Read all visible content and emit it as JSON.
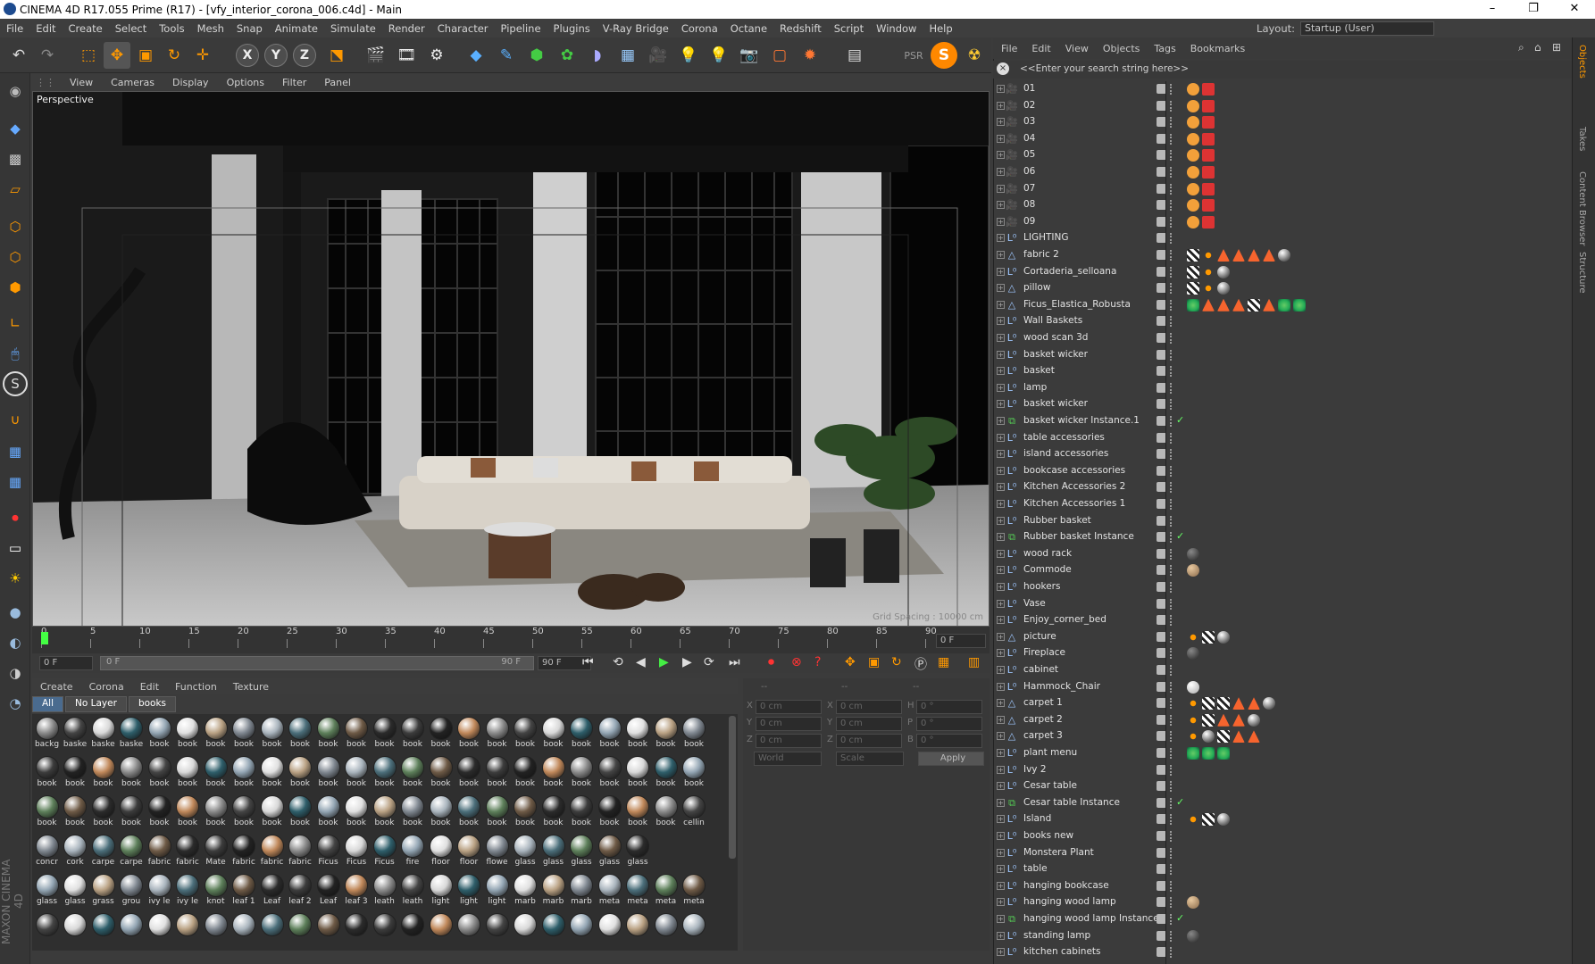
{
  "window": {
    "title": "CINEMA 4D R17.055 Prime (R17) - [vfy_interior_corona_006.c4d] - Main",
    "min_glyph": "–",
    "max_glyph": "❐",
    "close_glyph": "✕"
  },
  "menubar": {
    "items": [
      "File",
      "Edit",
      "Create",
      "Select",
      "Tools",
      "Mesh",
      "Snap",
      "Animate",
      "Simulate",
      "Render",
      "Character",
      "Pipeline",
      "Plugins",
      "V-Ray Bridge",
      "Corona",
      "Octane",
      "Redshift",
      "Script",
      "Window",
      "Help"
    ],
    "layout_label": "Layout:",
    "layout_value": "Startup (User)"
  },
  "toolbar": {
    "axis_x": "X",
    "axis_y": "Y",
    "axis_z": "Z"
  },
  "viewport": {
    "menu": [
      "View",
      "Cameras",
      "Display",
      "Options",
      "Filter",
      "Panel"
    ],
    "label": "Perspective",
    "grid_spacing": "Grid Spacing : 10000 cm"
  },
  "timeline": {
    "ticks": [
      "0",
      "5",
      "10",
      "15",
      "20",
      "25",
      "30",
      "35",
      "40",
      "45",
      "50",
      "55",
      "60",
      "65",
      "70",
      "75",
      "80",
      "85",
      "90"
    ],
    "current_frame": "0 F",
    "start_field": "0 F",
    "range_start": "0 F",
    "range_end": "90 F",
    "end_field": "90 F"
  },
  "material_manager": {
    "menu": [
      "Create",
      "Corona",
      "Edit",
      "Function",
      "Texture"
    ],
    "tabs": [
      "All",
      "No Layer",
      "books"
    ],
    "rows": [
      [
        "backg",
        "baske",
        "baske",
        "baske",
        "book",
        "book",
        "book",
        "book",
        "book",
        "book",
        "book",
        "book",
        "book",
        "book",
        "book",
        "book",
        "book",
        "book",
        "book",
        "book",
        "book",
        "book",
        "book",
        "book"
      ],
      [
        "book",
        "book",
        "book",
        "book",
        "book",
        "book",
        "book",
        "book",
        "book",
        "book",
        "book",
        "book",
        "book",
        "book",
        "book",
        "book",
        "book",
        "book",
        "book",
        "book",
        "book",
        "book",
        "book",
        "book"
      ],
      [
        "book",
        "book",
        "book",
        "book",
        "book",
        "book",
        "book",
        "book",
        "book",
        "book",
        "book",
        "book",
        "book",
        "book",
        "book",
        "book",
        "book",
        "book",
        "book",
        "book",
        "book",
        "book",
        "book",
        "cellin"
      ],
      [
        "concr",
        "cork",
        "carpe",
        "carpe",
        "fabric",
        "fabric",
        "Mate",
        "fabric",
        "fabric",
        "fabric",
        "Ficus",
        "Ficus",
        "Ficus",
        "fire",
        "floor",
        "floor",
        "flowe",
        "glass",
        "glass",
        "glass",
        "glass",
        "glass"
      ],
      [
        "glass",
        "glass",
        "grass",
        "grou",
        "ivy le",
        "ivy le",
        "knot",
        "leaf 1",
        "Leaf",
        "leaf 2",
        "Leaf",
        "leaf 3",
        "leath",
        "leath",
        "light",
        "light",
        "light",
        "marb",
        "marb",
        "marb",
        "meta",
        "meta",
        "meta",
        "meta"
      ],
      [
        "",
        "",
        "",
        "",
        "",
        "",
        "",
        "",
        "",
        "",
        "",
        "",
        "",
        "",
        "",
        "",
        "",
        "",
        "",
        "",
        "",
        "",
        "",
        ""
      ]
    ],
    "colors": [
      "#8a8a8a",
      "#6e5a46",
      "#b9a183",
      "#444",
      "#2b2b2b",
      "#7f8790",
      "#d8d8d8",
      "#3c3c3c",
      "#a9b4bd",
      "#2e5e6a",
      "#222",
      "#4b6e7a",
      "#93a5b3",
      "#c0885a",
      "#5d7f5a",
      "#e0e0e0"
    ]
  },
  "coordinates": {
    "x_label": "X",
    "y_label": "Y",
    "z_label": "Z",
    "h_label": "H",
    "p_label": "P",
    "b_label": "B",
    "x_val": "0 cm",
    "y_val": "0 cm",
    "z_val": "0 cm",
    "sx_val": "0 cm",
    "sy_val": "0 cm",
    "sz_val": "0 cm",
    "h_val": "0 °",
    "p_val": "0 °",
    "b_val": "0 °",
    "dash1": "--",
    "dash2": "--",
    "dash3": "--",
    "world": "World",
    "scale": "Scale",
    "apply": "Apply"
  },
  "object_manager": {
    "menu": [
      "File",
      "Edit",
      "View",
      "Objects",
      "Tags",
      "Bookmarks"
    ],
    "search_placeholder": "<<Enter your search string here>>",
    "objects": [
      {
        "name": "01",
        "icon": "camera",
        "tags": [
          "phong",
          "rs"
        ]
      },
      {
        "name": "02",
        "icon": "camera",
        "tags": [
          "phong",
          "rs"
        ]
      },
      {
        "name": "03",
        "icon": "camera",
        "tags": [
          "phong",
          "rs"
        ]
      },
      {
        "name": "04",
        "icon": "camera",
        "tags": [
          "phong",
          "rs"
        ]
      },
      {
        "name": "05",
        "icon": "camera",
        "tags": [
          "phong",
          "rs"
        ]
      },
      {
        "name": "06",
        "icon": "camera",
        "tags": [
          "phong",
          "rs"
        ]
      },
      {
        "name": "07",
        "icon": "camera",
        "tags": [
          "phong",
          "rs"
        ]
      },
      {
        "name": "08",
        "icon": "camera",
        "tags": [
          "phong",
          "rs"
        ]
      },
      {
        "name": "09",
        "icon": "camera",
        "tags": [
          "phong",
          "rs"
        ]
      },
      {
        "name": "LIGHTING",
        "icon": "null",
        "tags": []
      },
      {
        "name": "fabric 2",
        "icon": "poly",
        "tags": [
          "check",
          "dot",
          "tri",
          "tri",
          "tri",
          "tri",
          "ball"
        ]
      },
      {
        "name": "Cortaderia_selloana",
        "icon": "null",
        "tags": [
          "check",
          "dot",
          "ball"
        ]
      },
      {
        "name": "pillow",
        "icon": "poly",
        "tags": [
          "check",
          "dot",
          "ball"
        ]
      },
      {
        "name": "Ficus_Elastica_Robusta",
        "icon": "poly",
        "tags": [
          "green",
          "tri",
          "tri",
          "tri",
          "check",
          "tri",
          "green",
          "green"
        ]
      },
      {
        "name": "Wall Baskets",
        "icon": "null",
        "tags": []
      },
      {
        "name": "wood scan 3d",
        "icon": "null",
        "tags": []
      },
      {
        "name": "basket wicker",
        "icon": "null",
        "tags": []
      },
      {
        "name": "basket",
        "icon": "null",
        "tags": []
      },
      {
        "name": "lamp",
        "icon": "null",
        "tags": []
      },
      {
        "name": "basket wicker",
        "icon": "null",
        "tags": []
      },
      {
        "name": "basket wicker Instance.1",
        "icon": "inst",
        "tags": [],
        "check": true
      },
      {
        "name": "table accessories",
        "icon": "null",
        "tags": []
      },
      {
        "name": "island accessories",
        "icon": "null",
        "tags": []
      },
      {
        "name": "bookcase  accessories",
        "icon": "null",
        "tags": []
      },
      {
        "name": "Kitchen Accessories 2",
        "icon": "null",
        "tags": []
      },
      {
        "name": "Kitchen Accessories  1",
        "icon": "null",
        "tags": []
      },
      {
        "name": "Rubber basket",
        "icon": "null",
        "tags": []
      },
      {
        "name": "Rubber basket Instance",
        "icon": "inst",
        "tags": [],
        "check": true
      },
      {
        "name": "wood rack",
        "icon": "null",
        "tags": [
          "dark"
        ]
      },
      {
        "name": "Commode",
        "icon": "null",
        "tags": [
          "tan"
        ]
      },
      {
        "name": "hookers",
        "icon": "null",
        "tags": []
      },
      {
        "name": "Vase",
        "icon": "null",
        "tags": []
      },
      {
        "name": "Enjoy_corner_bed",
        "icon": "null",
        "tags": []
      },
      {
        "name": "picture",
        "icon": "poly",
        "tags": [
          "dot",
          "check",
          "ball"
        ]
      },
      {
        "name": "Fireplace",
        "icon": "null",
        "tags": [
          "dark"
        ]
      },
      {
        "name": "cabinet",
        "icon": "null",
        "tags": []
      },
      {
        "name": "Hammock_Chair",
        "icon": "null",
        "tags": [
          "white"
        ]
      },
      {
        "name": "carpet 1",
        "icon": "poly",
        "tags": [
          "dot",
          "check",
          "check",
          "tri",
          "tri",
          "ball"
        ]
      },
      {
        "name": "carpet 2",
        "icon": "poly",
        "tags": [
          "dot",
          "check",
          "tri",
          "tri",
          "ball"
        ]
      },
      {
        "name": "carpet 3",
        "icon": "poly",
        "tags": [
          "dot",
          "ball",
          "check",
          "tri",
          "tri"
        ]
      },
      {
        "name": "plant menu",
        "icon": "null",
        "tags": [
          "green",
          "green",
          "green"
        ]
      },
      {
        "name": "Ivy 2",
        "icon": "null",
        "tags": []
      },
      {
        "name": "Cesar table",
        "icon": "null",
        "tags": []
      },
      {
        "name": "Cesar table  Instance",
        "icon": "inst",
        "tags": [],
        "check": true
      },
      {
        "name": "Island",
        "icon": "null",
        "tags": [
          "dot",
          "check",
          "ball"
        ]
      },
      {
        "name": "books new",
        "icon": "null",
        "tags": []
      },
      {
        "name": "Monstera Plant",
        "icon": "null",
        "tags": []
      },
      {
        "name": "table",
        "icon": "null",
        "tags": []
      },
      {
        "name": "hanging bookcase",
        "icon": "null",
        "tags": []
      },
      {
        "name": "hanging wood lamp",
        "icon": "null",
        "tags": [
          "tan"
        ]
      },
      {
        "name": "hanging wood lamp Instance",
        "icon": "inst",
        "tags": [],
        "check": true
      },
      {
        "name": "standing lamp",
        "icon": "null",
        "tags": [
          "dark"
        ]
      },
      {
        "name": "kitchen cabinets",
        "icon": "null",
        "tags": []
      }
    ]
  },
  "side_tabs": [
    "Objects",
    "Takes",
    "Content Browser",
    "Structure"
  ],
  "branding": "MAXON CINEMA 4D"
}
